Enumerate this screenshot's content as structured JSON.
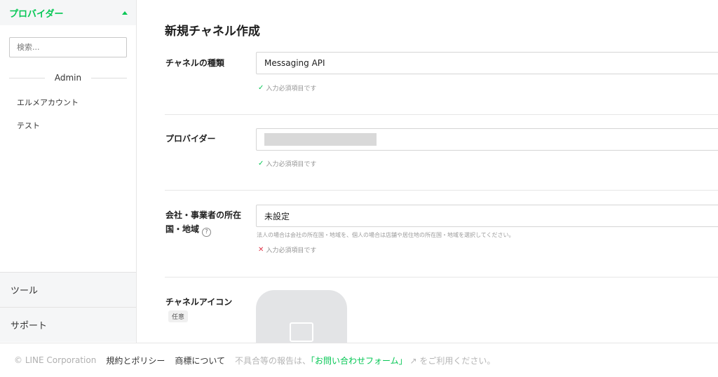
{
  "sidebar": {
    "provider_label": "プロバイダー",
    "search_placeholder": "検索...",
    "group_label": "Admin",
    "items": [
      {
        "label": "エルメアカウント"
      },
      {
        "label": "テスト"
      }
    ],
    "bottom_items": [
      {
        "label": "ツール"
      },
      {
        "label": "サポート"
      }
    ]
  },
  "main": {
    "title": "新規チャネル作成",
    "channel_type": {
      "label": "チャネルの種類",
      "value": "Messaging API",
      "hint": "入力必須項目です"
    },
    "provider": {
      "label": "プロバイダー",
      "hint": "入力必須項目です"
    },
    "region": {
      "label_line1": "会社・事業者の所在",
      "label_line2": "国・地域",
      "value": "未設定",
      "description": "法人の場合は会社の所在国・地域を、個人の場合は店舗や居住地の所在国・地域を選択してください。",
      "error": "入力必須項目です"
    },
    "icon": {
      "label": "チャネルアイコン",
      "badge": "任意"
    }
  },
  "footer": {
    "copyright": "© LINE Corporation",
    "terms": "規約とポリシー",
    "trademark": "商標について",
    "note_prefix": "不具合等の報告は、",
    "form_link": "「お問い合わせフォーム」",
    "note_suffix": "をご利用ください。"
  },
  "colors": {
    "accent": "#06c755",
    "error": "#e0384b"
  }
}
